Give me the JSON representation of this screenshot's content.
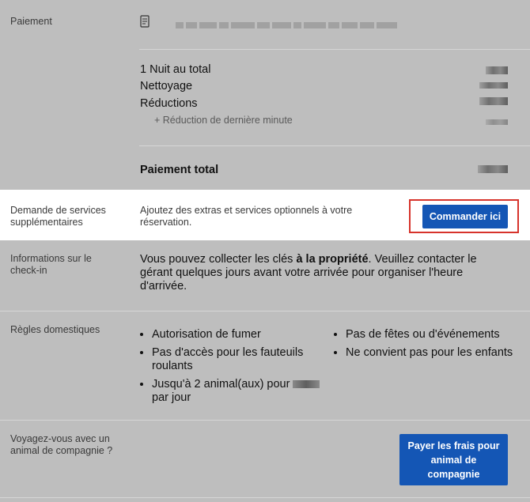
{
  "payment": {
    "label": "Paiement",
    "icon": "receipt-icon"
  },
  "price_lines": [
    {
      "label": "1 Nuit au total"
    },
    {
      "label": "Nettoyage"
    },
    {
      "label": "Réductions"
    }
  ],
  "discount_sub": "+ Réduction de dernière minute",
  "total_label": "Paiement total",
  "extra_services": {
    "label": "Demande de services supplémentaires",
    "description": "Ajoutez des extras et services optionnels à votre réservation.",
    "button": "Commander ici"
  },
  "checkin": {
    "label": "Informations sur le check-in",
    "text_before": "Vous pouvez collecter les clés ",
    "text_bold": "à la propriété",
    "text_after": ". Veuillez contacter le gérant quelques jours avant votre arrivée pour organiser l'heure d'arrivée."
  },
  "house_rules": {
    "label": "Règles domestiques",
    "left": [
      "Autorisation de fumer",
      "Pas d'accès pour les fauteuils roulants"
    ],
    "pet_rule_prefix": "Jusqu'à 2 animal(aux) pour",
    "pet_rule_suffix": "par jour",
    "right": [
      "Pas de fêtes ou d'événements",
      "Ne convient pas pour les enfants"
    ]
  },
  "pets": {
    "label": "Voyagez-vous avec un animal de compagnie ?",
    "button": "Payer les frais pour animal de compagnie"
  },
  "colors": {
    "accent": "#1456b5",
    "highlight_border": "#d7332b",
    "background": "#bebebe"
  }
}
